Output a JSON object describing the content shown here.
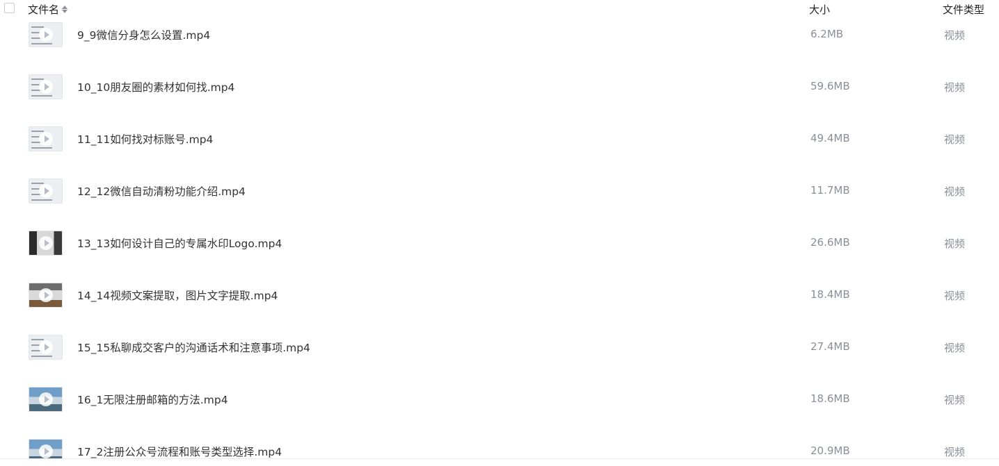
{
  "header": {
    "name_label": "文件名",
    "size_label": "大小",
    "type_label": "文件类型"
  },
  "files": [
    {
      "name": "9_9微信分身怎么设置.mp4",
      "size": "6.2MB",
      "type": "视频",
      "thumb": "light"
    },
    {
      "name": "10_10朋友圈的素材如何找.mp4",
      "size": "59.6MB",
      "type": "视频",
      "thumb": "light"
    },
    {
      "name": "11_11如何找对标账号.mp4",
      "size": "49.4MB",
      "type": "视频",
      "thumb": "light"
    },
    {
      "name": "12_12微信自动清粉功能介绍.mp4",
      "size": "11.7MB",
      "type": "视频",
      "thumb": "light"
    },
    {
      "name": "13_13如何设计自己的专属水印Logo.mp4",
      "size": "26.6MB",
      "type": "视频",
      "thumb": "dark"
    },
    {
      "name": "14_14视频文案提取，图片文字提取.mp4",
      "size": "18.4MB",
      "type": "视频",
      "thumb": "gray"
    },
    {
      "name": "15_15私聊成交客户的沟通话术和注意事项.mp4",
      "size": "27.4MB",
      "type": "视频",
      "thumb": "light"
    },
    {
      "name": "16_1无限注册邮箱的方法.mp4",
      "size": "18.6MB",
      "type": "视频",
      "thumb": "blue"
    },
    {
      "name": "17_2注册公众号流程和账号类型选择.mp4",
      "size": "20.9MB",
      "type": "视频",
      "thumb": "blue"
    }
  ],
  "colors": {
    "text": "#333333",
    "muted": "#8a8e96",
    "header_text": "#222222"
  }
}
